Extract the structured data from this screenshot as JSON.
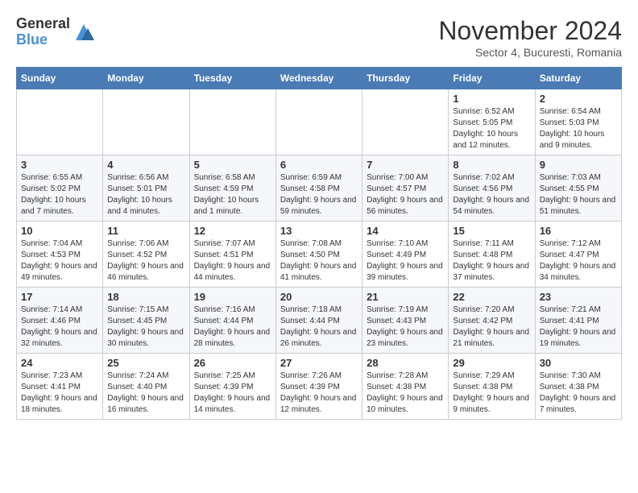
{
  "logo": {
    "general": "General",
    "blue": "Blue"
  },
  "title": "November 2024",
  "subtitle": "Sector 4, Bucuresti, Romania",
  "weekdays": [
    "Sunday",
    "Monday",
    "Tuesday",
    "Wednesday",
    "Thursday",
    "Friday",
    "Saturday"
  ],
  "weeks": [
    [
      {
        "day": "",
        "info": ""
      },
      {
        "day": "",
        "info": ""
      },
      {
        "day": "",
        "info": ""
      },
      {
        "day": "",
        "info": ""
      },
      {
        "day": "",
        "info": ""
      },
      {
        "day": "1",
        "info": "Sunrise: 6:52 AM\nSunset: 5:05 PM\nDaylight: 10 hours and 12 minutes."
      },
      {
        "day": "2",
        "info": "Sunrise: 6:54 AM\nSunset: 5:03 PM\nDaylight: 10 hours and 9 minutes."
      }
    ],
    [
      {
        "day": "3",
        "info": "Sunrise: 6:55 AM\nSunset: 5:02 PM\nDaylight: 10 hours and 7 minutes."
      },
      {
        "day": "4",
        "info": "Sunrise: 6:56 AM\nSunset: 5:01 PM\nDaylight: 10 hours and 4 minutes."
      },
      {
        "day": "5",
        "info": "Sunrise: 6:58 AM\nSunset: 4:59 PM\nDaylight: 10 hours and 1 minute."
      },
      {
        "day": "6",
        "info": "Sunrise: 6:59 AM\nSunset: 4:58 PM\nDaylight: 9 hours and 59 minutes."
      },
      {
        "day": "7",
        "info": "Sunrise: 7:00 AM\nSunset: 4:57 PM\nDaylight: 9 hours and 56 minutes."
      },
      {
        "day": "8",
        "info": "Sunrise: 7:02 AM\nSunset: 4:56 PM\nDaylight: 9 hours and 54 minutes."
      },
      {
        "day": "9",
        "info": "Sunrise: 7:03 AM\nSunset: 4:55 PM\nDaylight: 9 hours and 51 minutes."
      }
    ],
    [
      {
        "day": "10",
        "info": "Sunrise: 7:04 AM\nSunset: 4:53 PM\nDaylight: 9 hours and 49 minutes."
      },
      {
        "day": "11",
        "info": "Sunrise: 7:06 AM\nSunset: 4:52 PM\nDaylight: 9 hours and 46 minutes."
      },
      {
        "day": "12",
        "info": "Sunrise: 7:07 AM\nSunset: 4:51 PM\nDaylight: 9 hours and 44 minutes."
      },
      {
        "day": "13",
        "info": "Sunrise: 7:08 AM\nSunset: 4:50 PM\nDaylight: 9 hours and 41 minutes."
      },
      {
        "day": "14",
        "info": "Sunrise: 7:10 AM\nSunset: 4:49 PM\nDaylight: 9 hours and 39 minutes."
      },
      {
        "day": "15",
        "info": "Sunrise: 7:11 AM\nSunset: 4:48 PM\nDaylight: 9 hours and 37 minutes."
      },
      {
        "day": "16",
        "info": "Sunrise: 7:12 AM\nSunset: 4:47 PM\nDaylight: 9 hours and 34 minutes."
      }
    ],
    [
      {
        "day": "17",
        "info": "Sunrise: 7:14 AM\nSunset: 4:46 PM\nDaylight: 9 hours and 32 minutes."
      },
      {
        "day": "18",
        "info": "Sunrise: 7:15 AM\nSunset: 4:45 PM\nDaylight: 9 hours and 30 minutes."
      },
      {
        "day": "19",
        "info": "Sunrise: 7:16 AM\nSunset: 4:44 PM\nDaylight: 9 hours and 28 minutes."
      },
      {
        "day": "20",
        "info": "Sunrise: 7:18 AM\nSunset: 4:44 PM\nDaylight: 9 hours and 26 minutes."
      },
      {
        "day": "21",
        "info": "Sunrise: 7:19 AM\nSunset: 4:43 PM\nDaylight: 9 hours and 23 minutes."
      },
      {
        "day": "22",
        "info": "Sunrise: 7:20 AM\nSunset: 4:42 PM\nDaylight: 9 hours and 21 minutes."
      },
      {
        "day": "23",
        "info": "Sunrise: 7:21 AM\nSunset: 4:41 PM\nDaylight: 9 hours and 19 minutes."
      }
    ],
    [
      {
        "day": "24",
        "info": "Sunrise: 7:23 AM\nSunset: 4:41 PM\nDaylight: 9 hours and 18 minutes."
      },
      {
        "day": "25",
        "info": "Sunrise: 7:24 AM\nSunset: 4:40 PM\nDaylight: 9 hours and 16 minutes."
      },
      {
        "day": "26",
        "info": "Sunrise: 7:25 AM\nSunset: 4:39 PM\nDaylight: 9 hours and 14 minutes."
      },
      {
        "day": "27",
        "info": "Sunrise: 7:26 AM\nSunset: 4:39 PM\nDaylight: 9 hours and 12 minutes."
      },
      {
        "day": "28",
        "info": "Sunrise: 7:28 AM\nSunset: 4:38 PM\nDaylight: 9 hours and 10 minutes."
      },
      {
        "day": "29",
        "info": "Sunrise: 7:29 AM\nSunset: 4:38 PM\nDaylight: 9 hours and 9 minutes."
      },
      {
        "day": "30",
        "info": "Sunrise: 7:30 AM\nSunset: 4:38 PM\nDaylight: 9 hours and 7 minutes."
      }
    ]
  ]
}
